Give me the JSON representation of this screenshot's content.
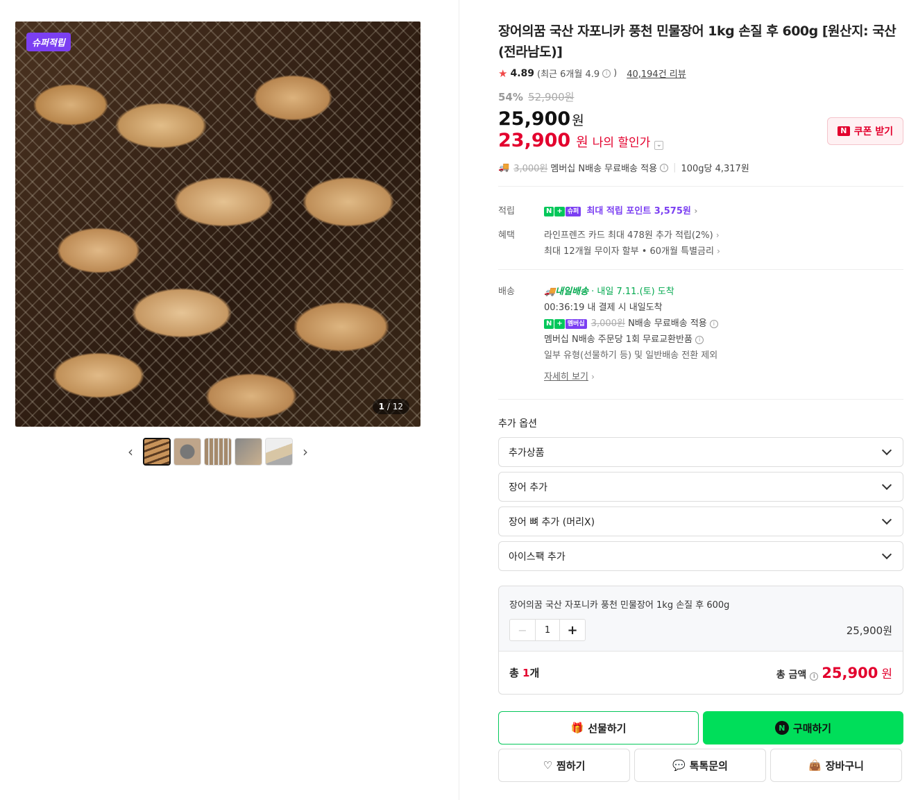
{
  "gallery": {
    "badge": "슈퍼적립",
    "counter_current": "1",
    "counter_total": "/ 12",
    "thumbnails": 5
  },
  "product": {
    "title": "장어의꿈 국산 자포니카 풍천 민물장어 1kg 손질 후 600g [원산지: 국산(전라남도)]",
    "rating": "4.89",
    "rating_recent": "(최근 6개월 4.9",
    "rating_recent_close": ")",
    "reviews": "40,194건 리뷰",
    "discount_pct": "54%",
    "original_price": "52,900원",
    "price": "25,900",
    "price_unit": "원",
    "my_price": "23,900",
    "my_price_unit": "원",
    "my_price_label": "나의 할인가",
    "coupon_label": "쿠폰 받기",
    "shipping_strike": "3,000원",
    "shipping_text": "멤버십 N배송 무료배송 적용",
    "unit_price": "100g당 4,317원"
  },
  "benefits": {
    "point_label": "적립",
    "n_badge": "N",
    "plus_badge": "+",
    "super_badge": "슈퍼",
    "point_text": "최대 적립 포인트 3,575원",
    "benefit_label": "혜택",
    "card_text": "라인프렌즈 카드 최대 478원 추가 적립(2%)",
    "installment_text": "최대 12개월 무이자 할부 • 60개월 특별금리"
  },
  "delivery": {
    "label": "배송",
    "type": "내일배송",
    "date": "· 내일 7.11.(토) 도착",
    "countdown": "00:36:19",
    "countdown_text": "내 결제 시 내일도착",
    "member_badge": "멤버십",
    "strike": "3,000원",
    "free_text": "N배송 무료배송 적용",
    "exchange_text": "멤버십 N배송 주문당 1회 무료교환반품",
    "exclude_text": "일부 유형(선물하기 등) 및 일반배송 전환 제외",
    "detail_link": "자세히 보기"
  },
  "options": {
    "title": "추가 옵션",
    "selects": [
      "추가상품",
      "장어 추가",
      "장어 뼈 추가 (머리X)",
      "아이스팩 추가"
    ]
  },
  "cart": {
    "item_name": "장어의꿈 국산 자포니카 풍천 민물장어 1kg 손질 후 600g",
    "quantity": "1",
    "line_price": "25,900원",
    "total_prefix": "총",
    "total_count": "1",
    "total_suffix": "개",
    "total_label": "총 금액",
    "total_amount": "25,900",
    "total_unit": "원"
  },
  "actions": {
    "gift": "선물하기",
    "buy": "구매하기",
    "wish": "찜하기",
    "talk": "톡톡문의",
    "cart": "장바구니"
  },
  "colors": {
    "accent_red": "#e3002d",
    "naver_green": "#03c75a",
    "super_purple": "#7b3ff2"
  }
}
